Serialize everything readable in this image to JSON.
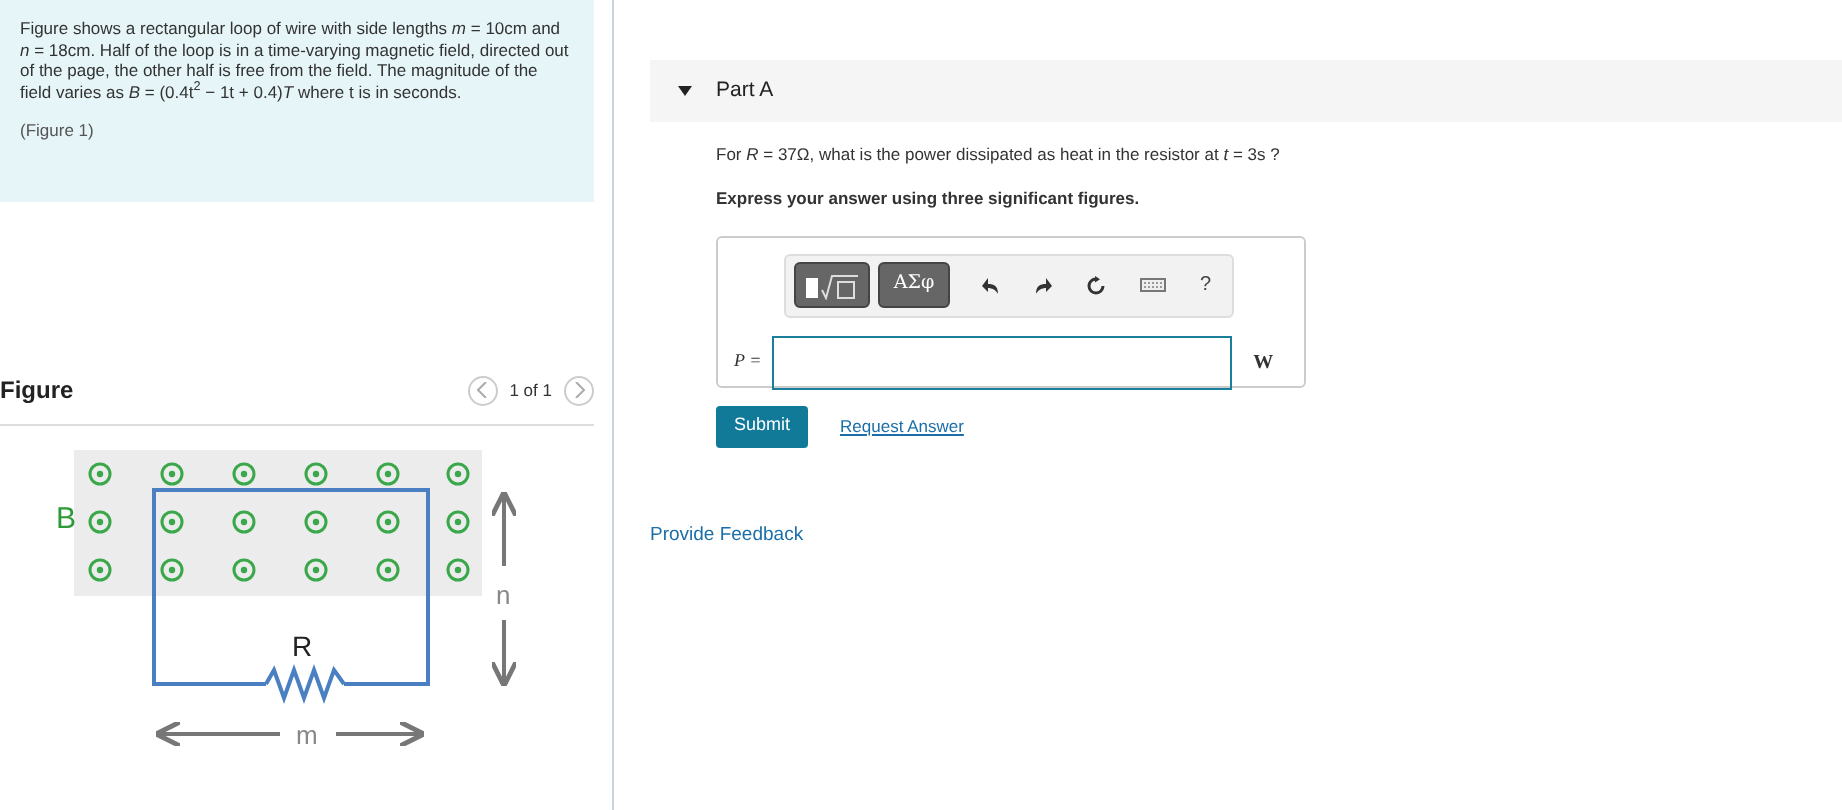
{
  "problem": {
    "text": "Figure shows a rectangular loop of wire with side lengths *m* = 10cm and *n* = 18cm. Half of the loop is in a time-varying magnetic field, directed out of the page, the other half is free from the field. The magnitude of the field varies as *B* = (0.4t$^{2}$ − 1t + 0.4)*T* where t is in seconds.",
    "figure_link": "(Figure 1)"
  },
  "figure": {
    "title": "Figure",
    "pager": "1 of 1",
    "labels": {
      "field": "B",
      "resistor": "R",
      "height": "n",
      "width": "m"
    }
  },
  "part": {
    "title": "Part A",
    "expanded": true,
    "question": "For *R* = 37Ω, what is the power dissipated as heat in the resistor at *t* = 3s ?",
    "instruction": "Express your answer using three significant figures.",
    "toolbar": {
      "templates": "ΑΣφ",
      "help": "?"
    },
    "answer": {
      "label": "P =",
      "unit": "W"
    },
    "submit": "Submit",
    "request": "Request Answer"
  },
  "feedback": "Provide Feedback"
}
